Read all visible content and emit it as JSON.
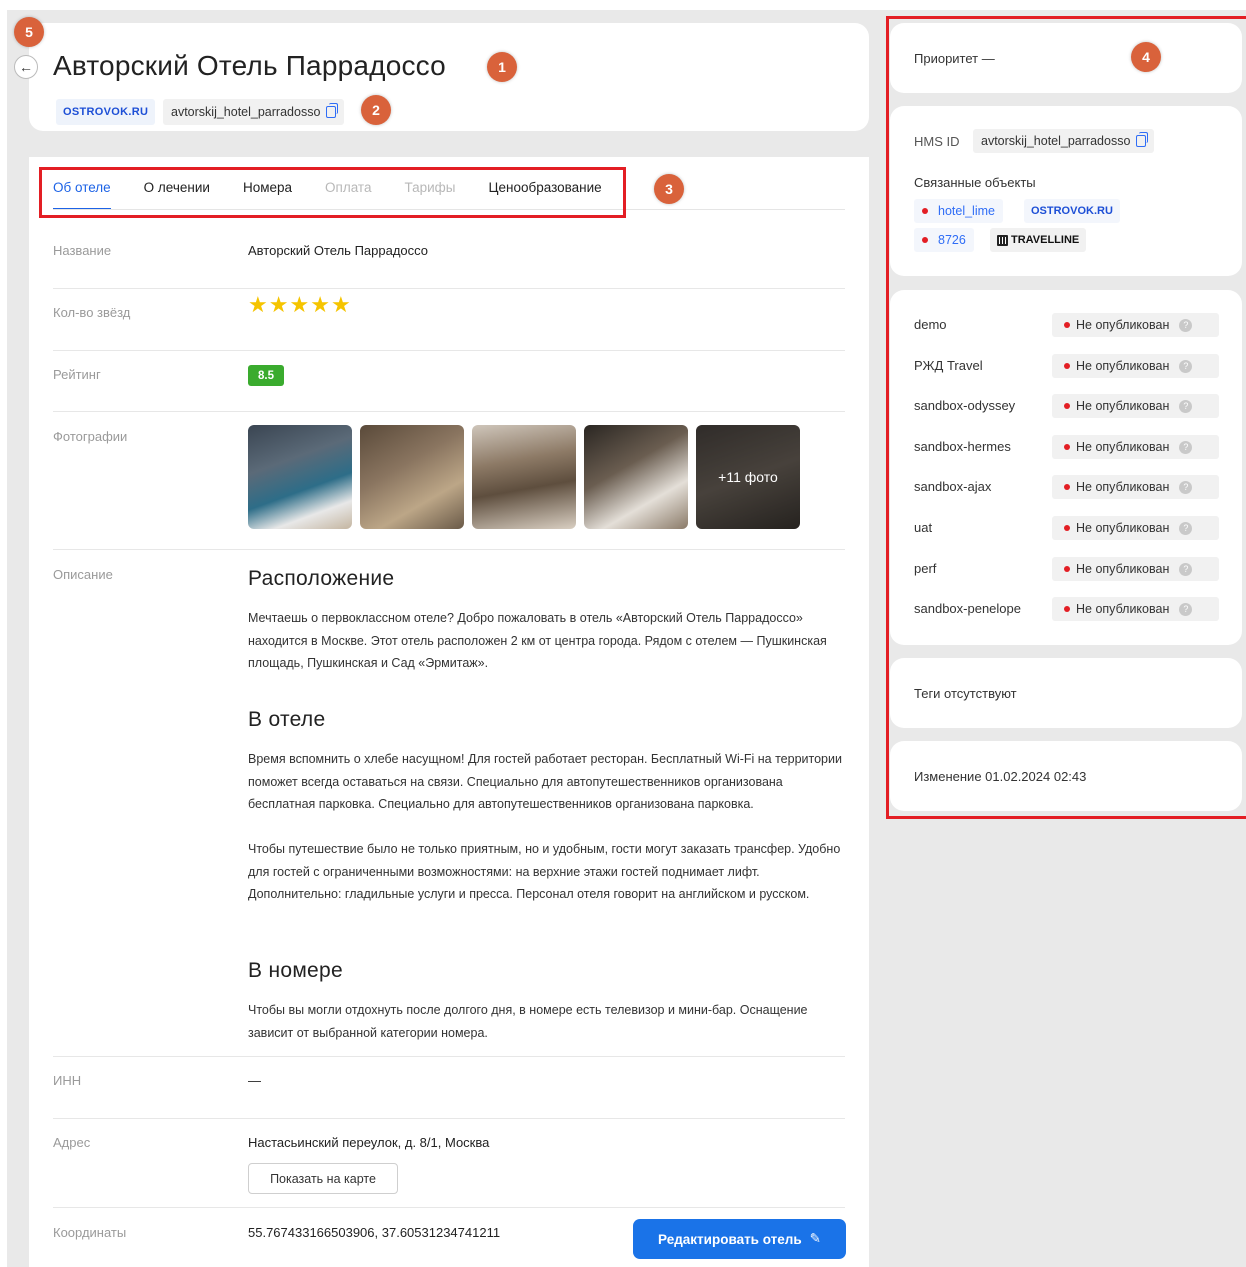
{
  "markers": [
    "1",
    "2",
    "3",
    "4",
    "5"
  ],
  "header": {
    "title": "Авторский Отель Паррадоссо",
    "source": "OSTROVOK.RU",
    "slug": "avtorskij_hotel_parradosso"
  },
  "tabs": [
    {
      "label": "Об отеле",
      "state": "active"
    },
    {
      "label": "О лечении",
      "state": "normal"
    },
    {
      "label": "Номера",
      "state": "normal"
    },
    {
      "label": "Оплата",
      "state": "disabled"
    },
    {
      "label": "Тарифы",
      "state": "disabled"
    },
    {
      "label": "Ценообразование",
      "state": "normal"
    }
  ],
  "fields": {
    "name_label": "Название",
    "name_value": "Авторский Отель Паррадоссо",
    "stars_label": "Кол-во звёзд",
    "stars_value": 5,
    "rating_label": "Рейтинг",
    "rating_value": "8.5",
    "photos_label": "Фотографии",
    "photos_more": "+11 фото",
    "description_label": "Описание",
    "inn_label": "ИНН",
    "inn_value": "—",
    "address_label": "Адрес",
    "address_value": "Настасьинский переулок, д. 8/1, Москва",
    "show_map": "Показать на карте",
    "coords_label": "Координаты",
    "coords_value": "55.767433166503906, 37.60531234741211"
  },
  "description": {
    "h1": "Расположение",
    "p1": "Мечтаешь о первоклассном отеле? Добро пожаловать в отель «Авторский Отель Паррадоссо» находится в Москве. Этот отель расположен 2 км от центра города. Рядом с отелем — Пушкинская площадь, Пушкинская и Сад «Эрмитаж».",
    "h2": "В отеле",
    "p2a": "Время вспомнить о хлебе насущном! Для гостей работает ресторан. Бесплатный Wi-Fi на территории поможет всегда оставаться на связи. Специально для автопутешественников организована бесплатная парковка. Специально для автопутешественников организована парковка.",
    "p2b": "Чтобы путешествие было не только приятным, но и удобным, гости могут заказать трансфер. Удобно для гостей с ограниченными возможностями: на верхние этажи гостей поднимает лифт. Дополнительно: гладильные услуги и пресса. Персонал отеля говорит на английском и русском.",
    "h3": "В номере",
    "p3": "Чтобы вы могли отдохнуть после долгого дня, в номере есть телевизор и мини-бар. Оснащение зависит от выбранной категории номера."
  },
  "edit_button": "Редактировать отель",
  "sidebar": {
    "priority": "Приоритет —",
    "hms_label": "HMS ID",
    "hms_value": "avtorskij_hotel_parradosso",
    "related_label": "Связанные объекты",
    "related": [
      {
        "id": "hotel_lime",
        "brand": "OSTROVOK.RU"
      },
      {
        "id": "8726",
        "brand": "TRAVELLINE"
      }
    ],
    "environments": [
      {
        "name": "demo",
        "status": "Не опубликован"
      },
      {
        "name": "РЖД Travel",
        "status": "Не опубликован"
      },
      {
        "name": "sandbox-odyssey",
        "status": "Не опубликован"
      },
      {
        "name": "sandbox-hermes",
        "status": "Не опубликован"
      },
      {
        "name": "sandbox-ajax",
        "status": "Не опубликован"
      },
      {
        "name": "uat",
        "status": "Не опубликован"
      },
      {
        "name": "perf",
        "status": "Не опубликован"
      },
      {
        "name": "sandbox-penelope",
        "status": "Не опубликован"
      }
    ],
    "tags": "Теги отсутствуют",
    "modified": "Изменение 01.02.2024 02:43"
  },
  "colors": {
    "accent": "#1a73e8",
    "marker": "#d9623b",
    "highlight": "#e31e24",
    "rating": "#3aab2e",
    "star": "#f5c400"
  }
}
